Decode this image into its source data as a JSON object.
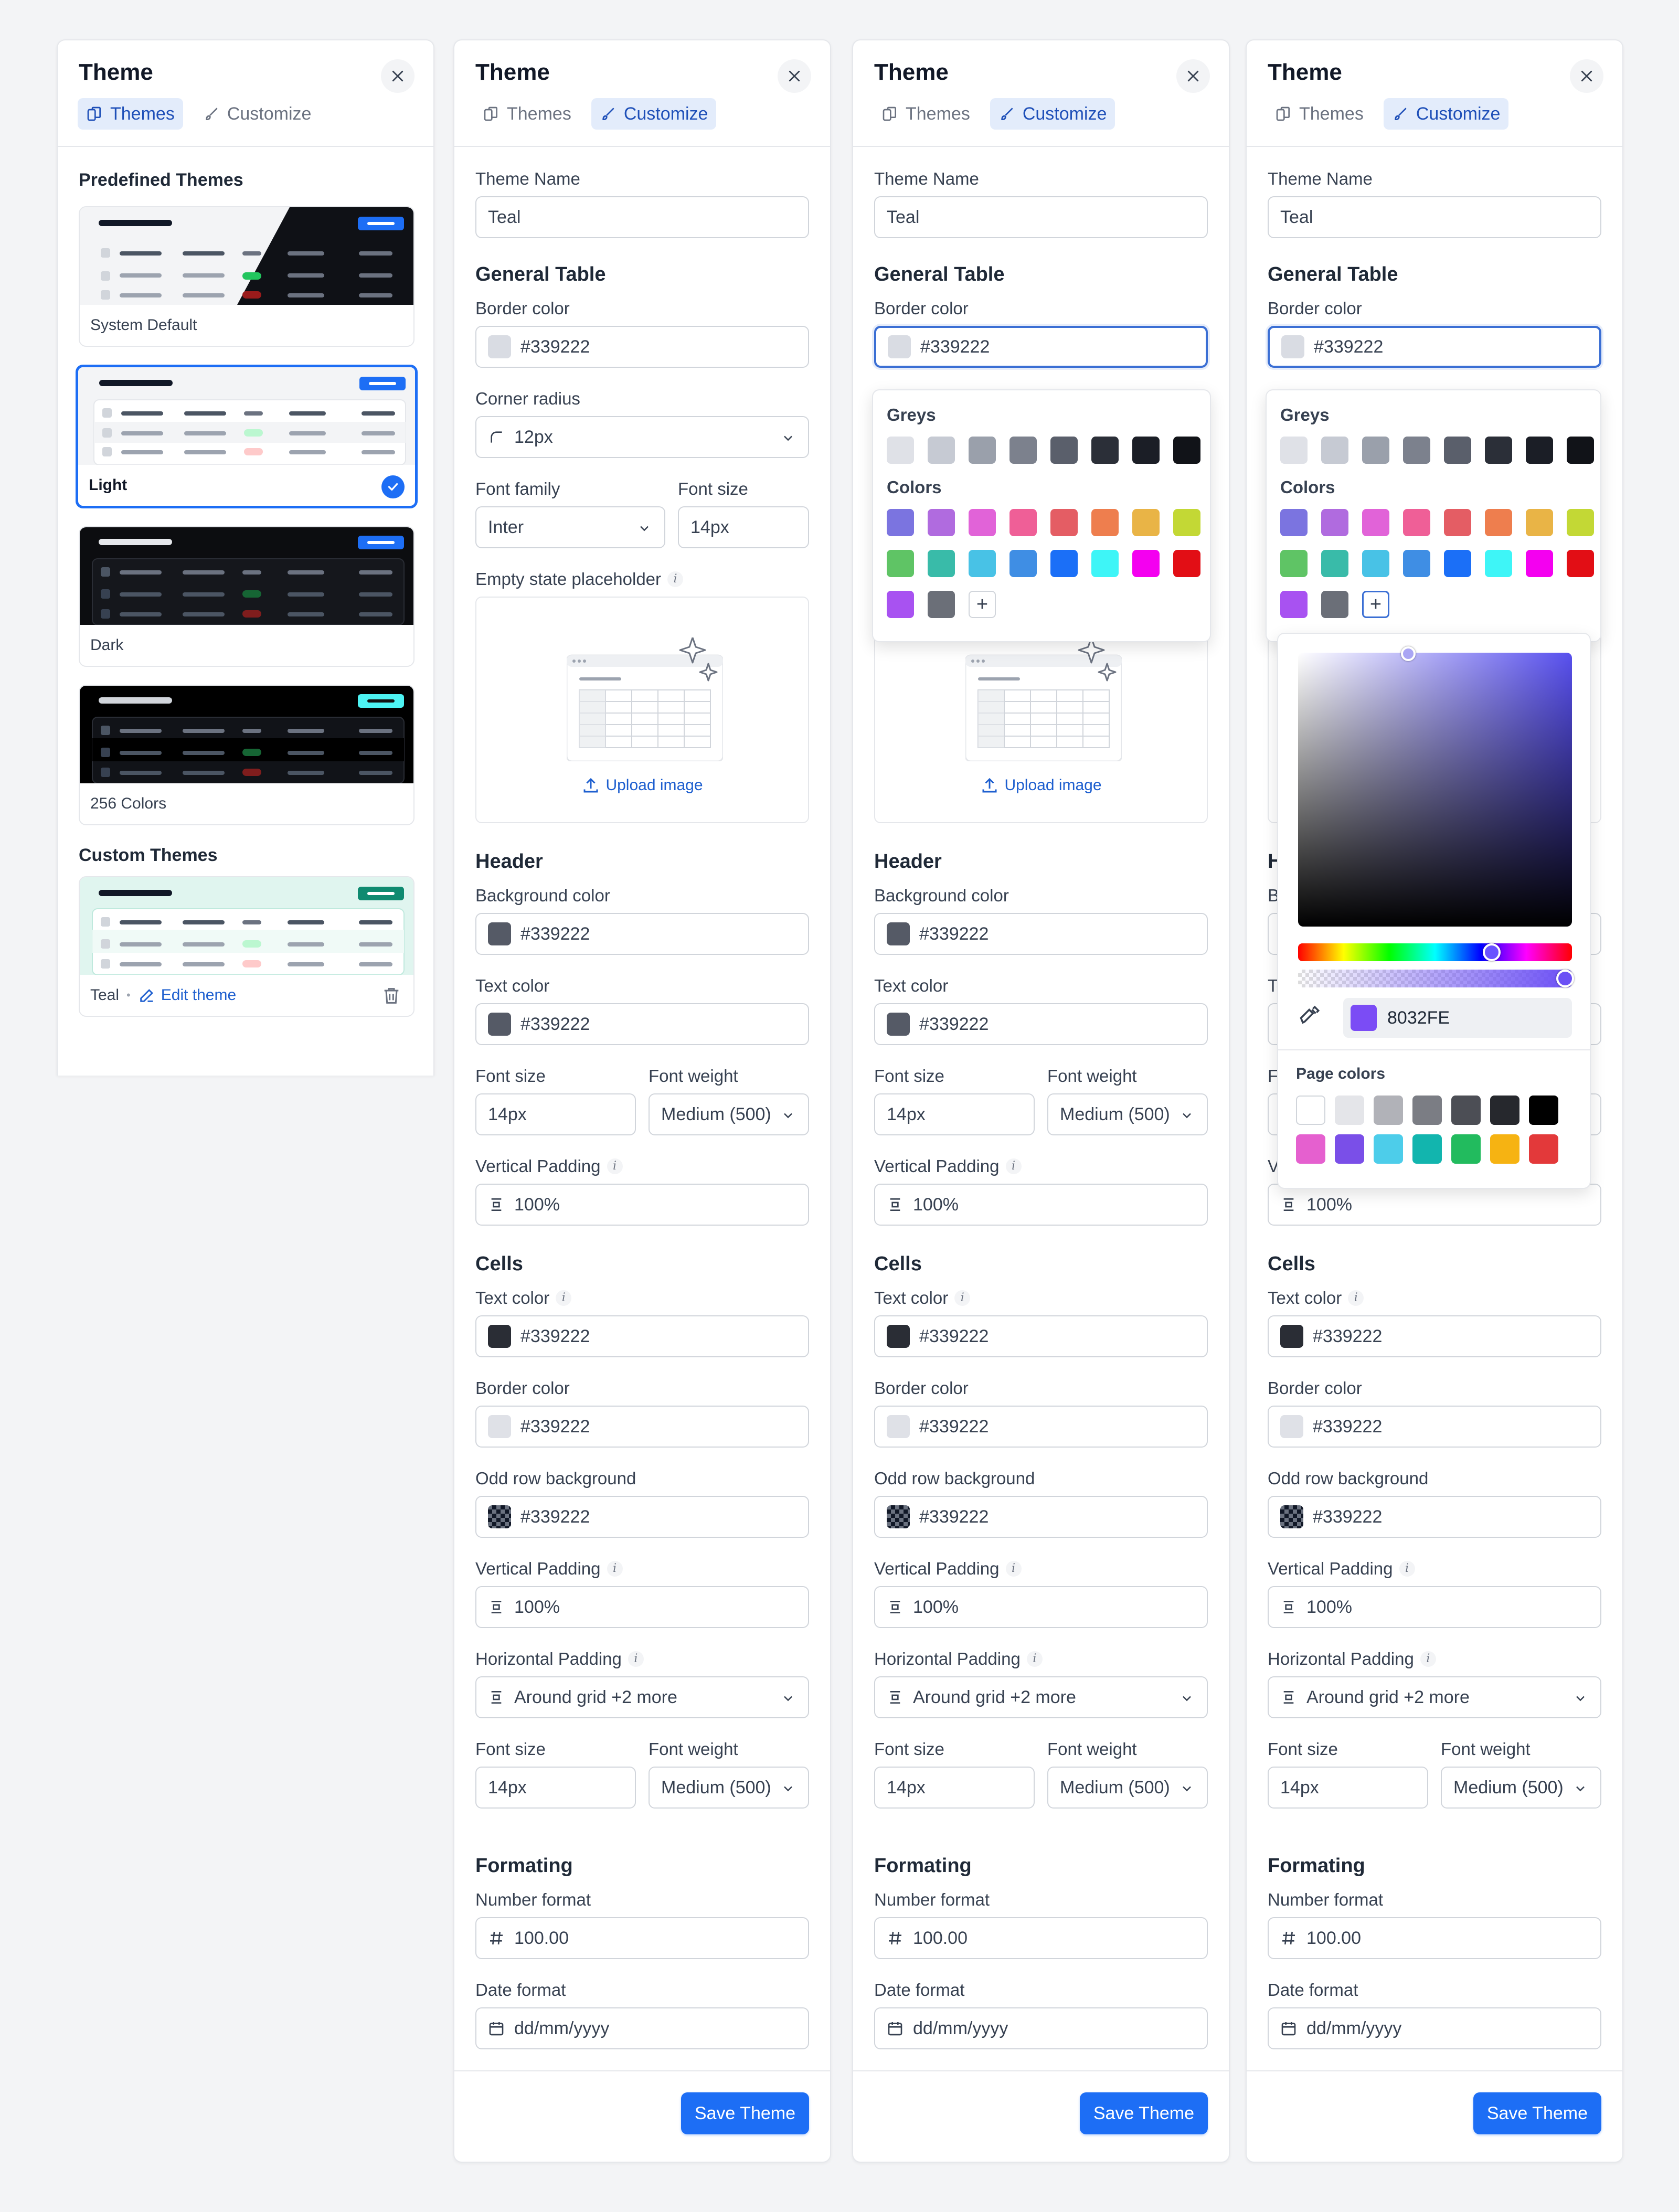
{
  "panel1": {
    "title": "Theme",
    "tabs": [
      "Themes",
      "Customize"
    ],
    "predefined_title": "Predefined Themes",
    "themes": [
      "System Default",
      "Light",
      "Dark",
      "256 Colors"
    ],
    "custom_title": "Custom Themes",
    "custom_theme": {
      "name": "Teal",
      "separator": "•",
      "edit": "Edit theme"
    }
  },
  "form": {
    "title": "Theme",
    "tabs": [
      "Themes",
      "Customize"
    ],
    "theme_name_label": "Theme Name",
    "theme_name_value": "Teal",
    "general_title": "General Table",
    "border_color_label": "Border color",
    "border_color_value": "#339222",
    "corner_radius_label": "Corner radius",
    "corner_radius_value": "12px",
    "font_family_label": "Font family",
    "font_family_value": "Inter",
    "font_size_label": "Font size",
    "font_size_value": "14px",
    "empty_state_label": "Empty state placeholder",
    "upload_label": "Upload image",
    "header_title": "Header",
    "bg_color_label": "Background color",
    "bg_color_value": "#339222",
    "text_color_label": "Text color",
    "text_color_value": "#339222",
    "font_weight_label": "Font weight",
    "font_weight_value": "Medium (500)",
    "vpad_label": "Vertical Padding",
    "vpad_value": "100%",
    "cells_title": "Cells",
    "cell_text_color_label": "Text color",
    "cell_border_color_label": "Border color",
    "odd_row_label": "Odd row background",
    "hpad_label": "Horizontal Padding",
    "hpad_value": "Around grid +2 more",
    "formatting_title": "Formating",
    "number_format_label": "Number format",
    "number_format_value": "100.00",
    "date_format_label": "Date format",
    "date_format_value": "dd/mm/yyyy",
    "save_label": "Save Theme",
    "info_glyph": "i"
  },
  "palette": {
    "greys_title": "Greys",
    "colors_title": "Colors",
    "add_glyph": "+",
    "greys": [
      "#dfe1e7",
      "#c6cad3",
      "#9aa0ab",
      "#7c818d",
      "#5a5f6b",
      "#2b2f38",
      "#1b1e26",
      "#111318"
    ],
    "colors": [
      "#7b74e0",
      "#b06bdf",
      "#e163d8",
      "#ef5f97",
      "#e45d64",
      "#ee7e4e",
      "#e9b446",
      "#c3d835",
      "#5fc465",
      "#39bba9",
      "#48c2e6",
      "#3f8ee4",
      "#1b6ff7",
      "#3ef5f7",
      "#f400f0",
      "#e20e15",
      "#a852f1",
      "#6b6f78"
    ]
  },
  "picker": {
    "hex": "8032FE",
    "page_colors_title": "Page colors",
    "page_colors": [
      "#ffffff",
      "#e4e5e9",
      "#b1b2b8",
      "#7b7d84",
      "#4c4e55",
      "#26282d",
      "#000000",
      "#e560cf",
      "#7a4fe8",
      "#4dcdea",
      "#12b5ae",
      "#22bb5e",
      "#f6b312",
      "#e3393a"
    ]
  },
  "colors": {
    "accent": "#1d6ef5",
    "swatch_light": "#d9dce3",
    "swatch_dark": "#555a66",
    "swatch_darker": "#2a2d35",
    "teal": "#0f8a70"
  }
}
